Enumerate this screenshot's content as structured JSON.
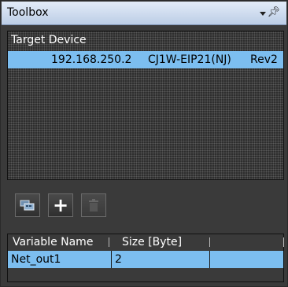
{
  "window": {
    "title": "Toolbox"
  },
  "target_device": {
    "header": "Target Device",
    "row": {
      "ip": "192.168.250.2",
      "model": "CJ1W-EIP21(NJ)",
      "revision": "Rev2"
    }
  },
  "toolbar": {
    "buttons": [
      {
        "name": "device-list-button",
        "icon": "network-devices-icon",
        "enabled": true
      },
      {
        "name": "add-button",
        "icon": "plus-icon",
        "enabled": true
      },
      {
        "name": "delete-button",
        "icon": "trash-icon",
        "enabled": false
      }
    ]
  },
  "variables": {
    "columns": [
      "Variable Name",
      "Size [Byte]"
    ],
    "rows": [
      {
        "name": "Net_out1",
        "size": "2"
      }
    ]
  },
  "colors": {
    "selection": "#7cbef0",
    "titlebar": "#bccde6",
    "panel": "#3a3a3a"
  }
}
